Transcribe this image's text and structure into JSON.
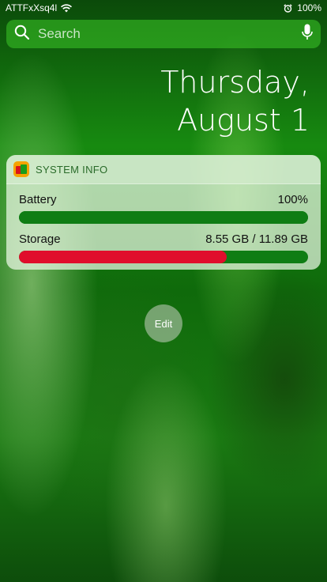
{
  "status_bar": {
    "carrier": "ATTFxXsq4l",
    "wifi_icon": "wifi-icon",
    "alarm_icon": "alarm-icon",
    "battery": "100%"
  },
  "search": {
    "placeholder": "Search",
    "icon": "search-icon",
    "mic_icon": "microphone-icon"
  },
  "date": {
    "line1": "Thursday,",
    "line2": "August 1"
  },
  "widget": {
    "title": "SYSTEM INFO",
    "metrics": [
      {
        "label": "Battery",
        "value": "100%",
        "fraction": 1.0,
        "fill_color": "#0f7d14",
        "track_color": "#0f7d14"
      },
      {
        "label": "Storage",
        "value": "8.55 GB / 11.89 GB",
        "fraction": 0.719,
        "fill_color": "#e00e2c",
        "track_color": "#0f7d14"
      }
    ]
  },
  "edit_button": {
    "label": "Edit"
  }
}
